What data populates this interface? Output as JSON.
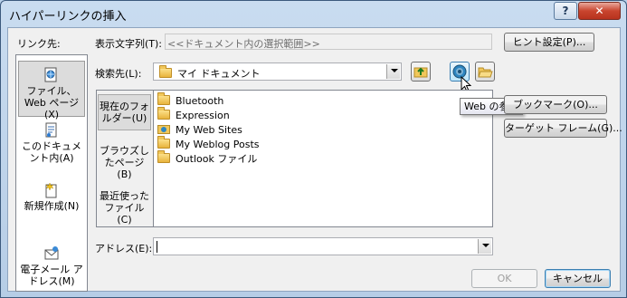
{
  "window": {
    "title": "ハイパーリンクの挿入",
    "help_label": "?",
    "close_label": "✕"
  },
  "linkbar": {
    "heading": "リンク先:",
    "items": [
      {
        "label": "ファイル、Web ページ(X)",
        "icon": "web-page-icon",
        "selected": true
      },
      {
        "label": "このドキュメント内(A)",
        "icon": "document-icon",
        "selected": false
      },
      {
        "label": "新規作成(N)",
        "icon": "new-document-icon",
        "selected": false
      },
      {
        "label": "電子メール アドレス(M)",
        "icon": "email-icon",
        "selected": false
      }
    ]
  },
  "display_text": {
    "label": "表示文字列(T):",
    "value": "<<ドキュメント内の選択範囲>>"
  },
  "screentip_button": "ヒント設定(P)...",
  "lookin": {
    "label": "検索先(L):",
    "value": "マイ ドキュメント"
  },
  "toolbar": {
    "up_folder": "up-folder-icon",
    "browse_web": "browse-web-icon",
    "browse_file": "open-folder-icon"
  },
  "tooltip": "Web の参照",
  "places": [
    {
      "label": "現在のフォルダー(U)",
      "selected": true
    },
    {
      "label": "ブラウズしたページ(B)",
      "selected": false
    },
    {
      "label": "最近使ったファイル(C)",
      "selected": false
    }
  ],
  "files": [
    {
      "name": "Bluetooth",
      "icon": "folder-icon"
    },
    {
      "name": "Expression",
      "icon": "folder-icon"
    },
    {
      "name": "My Web Sites",
      "icon": "web-folder-icon"
    },
    {
      "name": "My Weblog Posts",
      "icon": "folder-icon"
    },
    {
      "name": "Outlook ファイル",
      "icon": "folder-icon"
    }
  ],
  "side_buttons": {
    "bookmark": "ブックマーク(O)...",
    "target_frame": "ターゲット フレーム(G)..."
  },
  "address": {
    "label": "アドレス(E):",
    "value": ""
  },
  "buttons": {
    "ok": "OK",
    "cancel": "キャンセル"
  },
  "colors": {
    "titlebar": "#c9dcf0",
    "close": "#c9452f",
    "client": "#f0f0f0"
  }
}
